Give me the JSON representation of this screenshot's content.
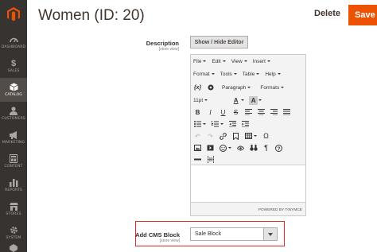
{
  "sidebar": {
    "logo": "magento-logo-icon",
    "items": [
      {
        "label": "DASHBOARD",
        "icon": "dashboard-icon",
        "active": false
      },
      {
        "label": "SALES",
        "icon": "dollar-icon",
        "active": false
      },
      {
        "label": "CATALOG",
        "icon": "box-icon",
        "active": true
      },
      {
        "label": "CUSTOMERS",
        "icon": "person-icon",
        "active": false
      },
      {
        "label": "MARKETING",
        "icon": "megaphone-icon",
        "active": false
      },
      {
        "label": "CONTENT",
        "icon": "layout-icon",
        "active": false
      },
      {
        "label": "REPORTS",
        "icon": "bar-chart-icon",
        "active": false
      },
      {
        "label": "STORES",
        "icon": "store-icon",
        "active": false
      },
      {
        "label": "SYSTEM",
        "icon": "gear-icon",
        "active": false
      }
    ]
  },
  "header": {
    "title": "Women (ID: 20)",
    "delete_label": "Delete",
    "save_label": "Save"
  },
  "description": {
    "label": "Description",
    "scope": "[store view]",
    "toggle_label": "Show / Hide Editor"
  },
  "editor": {
    "menu": [
      "File",
      "Edit",
      "View",
      "Insert"
    ],
    "menu2": [
      "Format",
      "Tools",
      "Table",
      "Help"
    ],
    "paragraph": "Paragraph",
    "formats": "Formats",
    "font_size": "11pt",
    "powered_by": "POWERED BY TINYMCE"
  },
  "cms_block": {
    "label": "Add CMS Block",
    "scope": "[store view]",
    "value": "Sale Block"
  },
  "colors": {
    "accent": "#eb5202",
    "sidebar": "#373330",
    "highlight": "#e02b27"
  }
}
